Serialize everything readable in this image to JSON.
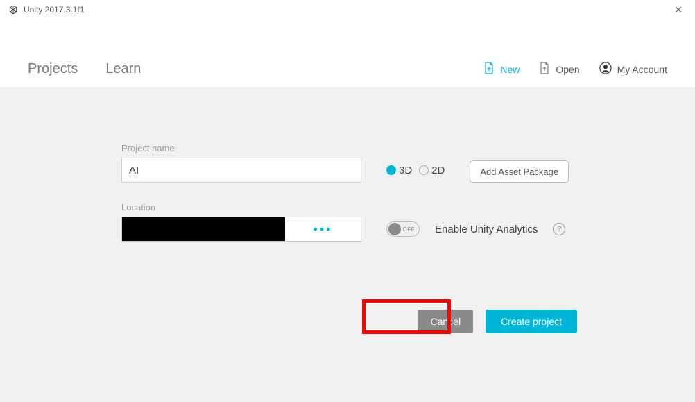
{
  "titleBar": {
    "title": "Unity 2017.3.1f1",
    "close": "✕"
  },
  "header": {
    "tabs": {
      "projects": "Projects",
      "learn": "Learn"
    },
    "actions": {
      "new": "New",
      "open": "Open",
      "account": "My Account"
    }
  },
  "form": {
    "projectName": {
      "label": "Project name",
      "value": "AI"
    },
    "location": {
      "label": "Location",
      "browse": "•••"
    },
    "dim": {
      "option3d": "3D",
      "option2d": "2D",
      "selected": "3D"
    },
    "addAssetPackage": "Add Asset Package",
    "analytics": {
      "toggleText": "OFF",
      "label": "Enable Unity Analytics",
      "help": "?"
    }
  },
  "footer": {
    "cancel": "Cancel",
    "create": "Create project"
  },
  "colors": {
    "accent": "#00b5d6",
    "highlight": "#ff0000"
  }
}
